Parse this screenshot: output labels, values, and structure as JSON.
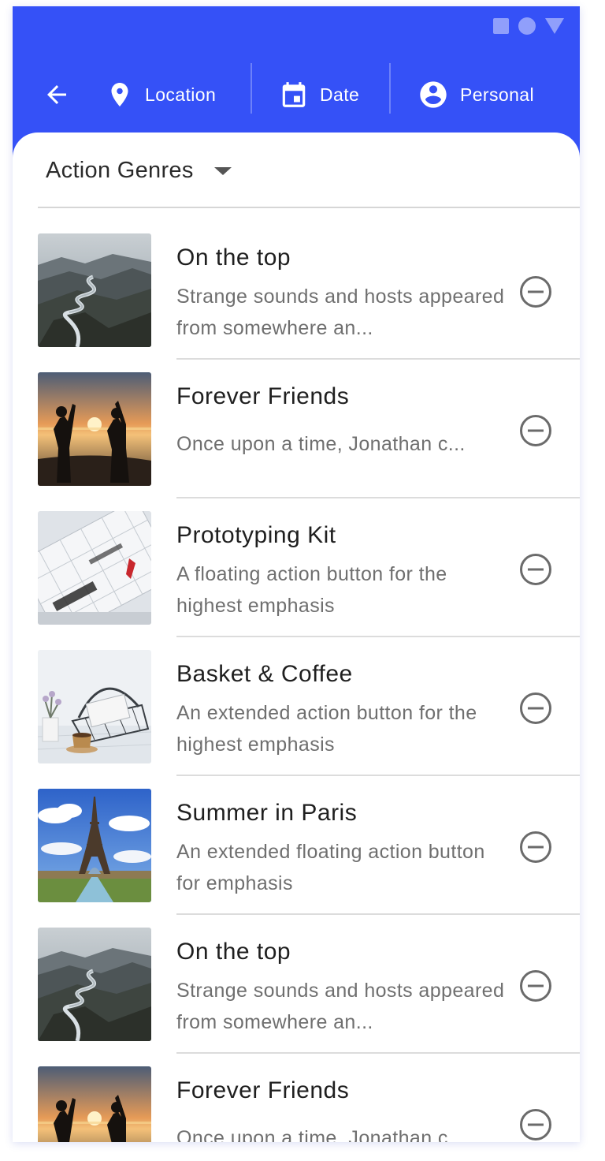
{
  "colors": {
    "primary": "#3551f7",
    "on_primary": "#ffffff",
    "title_text": "#1f1f1f",
    "secondary_text": "#6f6f6f",
    "divider": "#dcdcdc"
  },
  "status_bar": {
    "icons": [
      "square-icon",
      "circle-icon",
      "triangle-icon"
    ]
  },
  "nav": {
    "back_icon": "arrow-left-icon",
    "items": [
      {
        "label": "Location",
        "icon": "location-pin-icon"
      },
      {
        "label": "Date",
        "icon": "calendar-icon"
      },
      {
        "label": "Personal",
        "icon": "account-circle-icon"
      }
    ]
  },
  "filter": {
    "selected": "Action Genres",
    "icon": "dropdown-caret-icon"
  },
  "list": {
    "items": [
      {
        "title": "On the top",
        "subtitle": "Strange sounds and hosts appeared from somewhere an...",
        "image": "river-canyon",
        "action_icon": "remove-circle-icon"
      },
      {
        "title": "Forever Friends",
        "subtitle": "Once upon a time, Jonathan c...",
        "image": "friends-sunset",
        "action_icon": "remove-circle-icon"
      },
      {
        "title": "Prototyping Kit",
        "subtitle": "A floating action button for the highest emphasis",
        "image": "calendar-notebook",
        "action_icon": "remove-circle-icon"
      },
      {
        "title": "Basket & Coffee",
        "subtitle": "An extended action button for the highest emphasis",
        "image": "basket-coffee",
        "action_icon": "remove-circle-icon"
      },
      {
        "title": "Summer in Paris",
        "subtitle": "An extended floating action button for emphasis",
        "image": "eiffel-tower",
        "action_icon": "remove-circle-icon"
      },
      {
        "title": "On the top",
        "subtitle": "Strange sounds and hosts appeared from somewhere an...",
        "image": "river-canyon",
        "action_icon": "remove-circle-icon"
      },
      {
        "title": "Forever Friends",
        "subtitle": "Once upon a time, Jonathan c...",
        "image": "friends-sunset",
        "action_icon": "remove-circle-icon"
      }
    ]
  }
}
